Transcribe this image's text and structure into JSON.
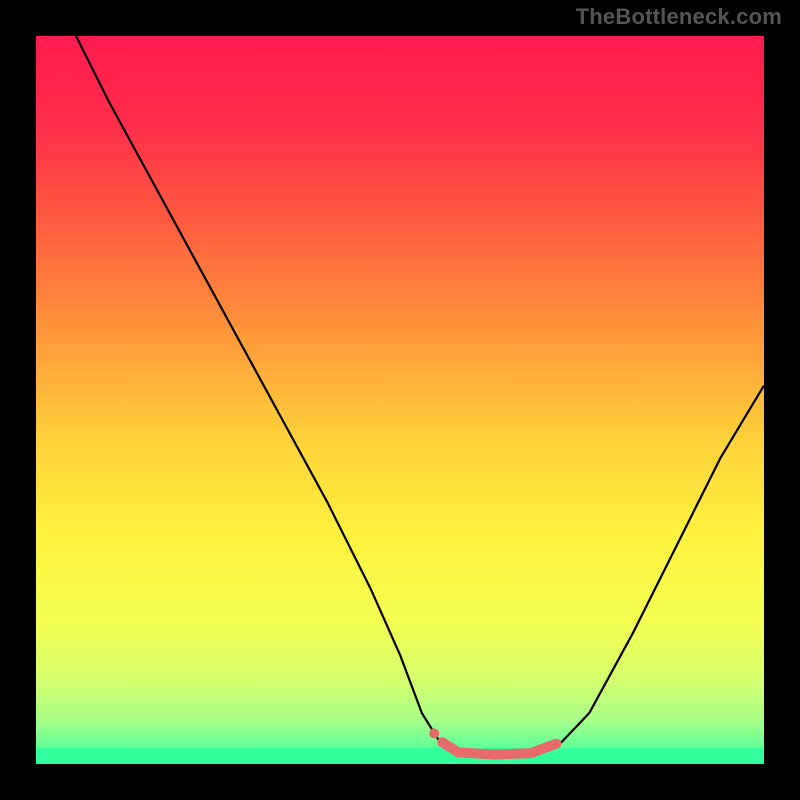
{
  "watermark": "TheBottleneck.com",
  "chart_data": {
    "type": "line",
    "title": "",
    "xlabel": "",
    "ylabel": "",
    "xlim": [
      0,
      100
    ],
    "ylim": [
      0,
      100
    ],
    "grid": false,
    "legend": false,
    "background_gradient": {
      "stops": [
        {
          "offset": 0.0,
          "color": "#ff1a4f"
        },
        {
          "offset": 0.12,
          "color": "#ff2d4a"
        },
        {
          "offset": 0.25,
          "color": "#ff5a3f"
        },
        {
          "offset": 0.4,
          "color": "#ff943a"
        },
        {
          "offset": 0.55,
          "color": "#ffd03a"
        },
        {
          "offset": 0.68,
          "color": "#fff13e"
        },
        {
          "offset": 0.8,
          "color": "#f4ff51"
        },
        {
          "offset": 0.88,
          "color": "#d7ff6a"
        },
        {
          "offset": 0.94,
          "color": "#a8ff88"
        },
        {
          "offset": 1.0,
          "color": "#35ffa0"
        }
      ]
    },
    "optimum_band": {
      "color": "#34ff9f",
      "y_from": 0,
      "y_to": 2.2
    },
    "series": [
      {
        "name": "bottleneck_curve",
        "stroke": "#000000",
        "stroke_width": 2.2,
        "points": [
          {
            "x": 5.5,
            "y": 100
          },
          {
            "x": 10,
            "y": 91
          },
          {
            "x": 16,
            "y": 80
          },
          {
            "x": 22,
            "y": 69
          },
          {
            "x": 28,
            "y": 58
          },
          {
            "x": 34,
            "y": 47
          },
          {
            "x": 40,
            "y": 36
          },
          {
            "x": 46,
            "y": 24
          },
          {
            "x": 50,
            "y": 15
          },
          {
            "x": 53,
            "y": 7
          },
          {
            "x": 55.5,
            "y": 3
          },
          {
            "x": 58,
            "y": 1.5
          },
          {
            "x": 63,
            "y": 1.2
          },
          {
            "x": 68,
            "y": 1.4
          },
          {
            "x": 72,
            "y": 2.8
          },
          {
            "x": 76,
            "y": 7
          },
          {
            "x": 82,
            "y": 18
          },
          {
            "x": 88,
            "y": 30
          },
          {
            "x": 94,
            "y": 42
          },
          {
            "x": 100,
            "y": 52
          }
        ]
      },
      {
        "name": "optimum_marker",
        "type": "overlay_segment",
        "stroke": "#e86a6a",
        "stroke_width": 10,
        "linecap": "round",
        "points": [
          {
            "x": 55.8,
            "y": 3.0
          },
          {
            "x": 58,
            "y": 1.6
          },
          {
            "x": 63,
            "y": 1.3
          },
          {
            "x": 68,
            "y": 1.5
          },
          {
            "x": 71.5,
            "y": 2.8
          }
        ]
      },
      {
        "name": "optimum_marker_dot",
        "type": "dot",
        "fill": "#e86a6a",
        "r": 5,
        "point": {
          "x": 54.7,
          "y": 4.2
        }
      }
    ]
  }
}
